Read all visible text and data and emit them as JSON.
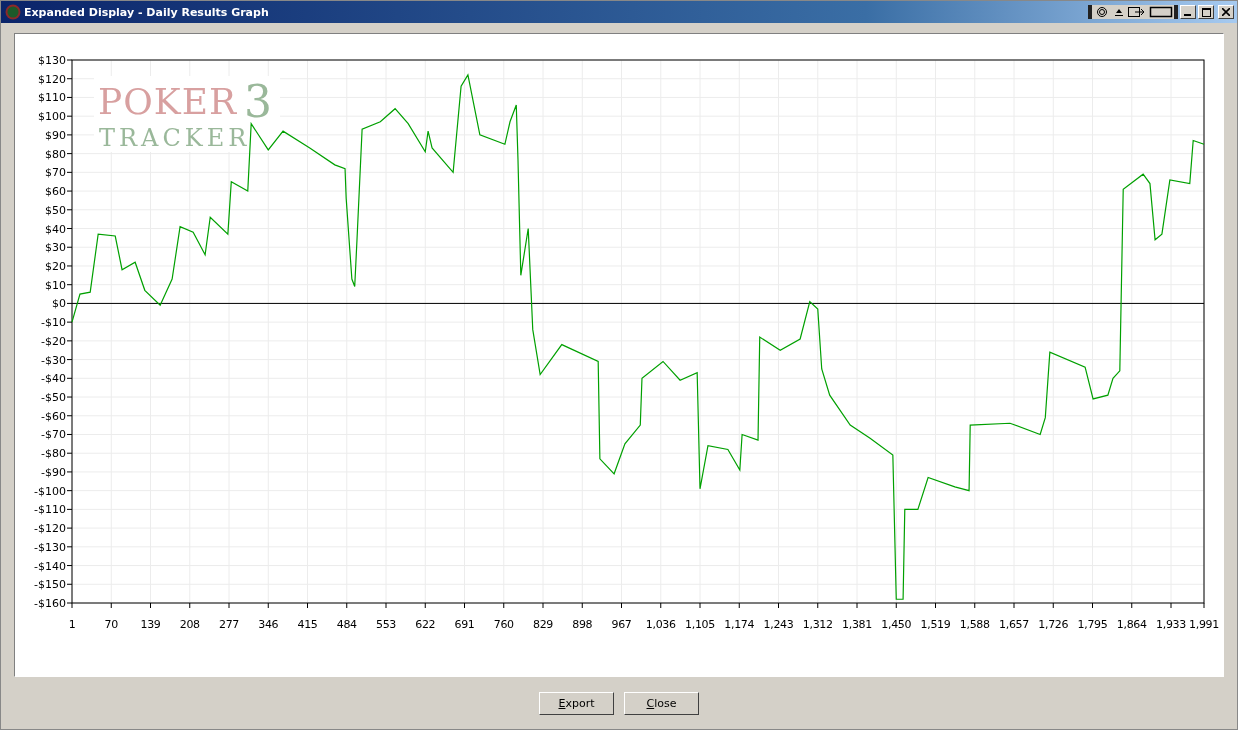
{
  "window": {
    "title": "Expanded Display - Daily Results Graph"
  },
  "graph": {
    "logo": {
      "top": "POKER",
      "bottom": "TRACKER",
      "mark": "3"
    },
    "chart_data": {
      "type": "line",
      "grid": true,
      "xlim": [
        1,
        1991
      ],
      "ylim": [
        -160,
        130
      ],
      "xticks": [
        {
          "value": 1,
          "label": "1"
        },
        {
          "value": 70,
          "label": "70"
        },
        {
          "value": 139,
          "label": "139"
        },
        {
          "value": 208,
          "label": "208"
        },
        {
          "value": 277,
          "label": "277"
        },
        {
          "value": 346,
          "label": "346"
        },
        {
          "value": 415,
          "label": "415"
        },
        {
          "value": 484,
          "label": "484"
        },
        {
          "value": 553,
          "label": "553"
        },
        {
          "value": 622,
          "label": "622"
        },
        {
          "value": 691,
          "label": "691"
        },
        {
          "value": 760,
          "label": "760"
        },
        {
          "value": 829,
          "label": "829"
        },
        {
          "value": 898,
          "label": "898"
        },
        {
          "value": 967,
          "label": "967"
        },
        {
          "value": 1036,
          "label": "1,036"
        },
        {
          "value": 1105,
          "label": "1,105"
        },
        {
          "value": 1174,
          "label": "1,174"
        },
        {
          "value": 1243,
          "label": "1,243"
        },
        {
          "value": 1312,
          "label": "1,312"
        },
        {
          "value": 1381,
          "label": "1,381"
        },
        {
          "value": 1450,
          "label": "1,450"
        },
        {
          "value": 1519,
          "label": "1,519"
        },
        {
          "value": 1588,
          "label": "1,588"
        },
        {
          "value": 1657,
          "label": "1,657"
        },
        {
          "value": 1726,
          "label": "1,726"
        },
        {
          "value": 1795,
          "label": "1,795"
        },
        {
          "value": 1864,
          "label": "1,864"
        },
        {
          "value": 1933,
          "label": "1,933"
        },
        {
          "value": 1991,
          "label": "1,991"
        }
      ],
      "yticks": [
        {
          "value": 130,
          "label": "$130"
        },
        {
          "value": 120,
          "label": "$120"
        },
        {
          "value": 110,
          "label": "$110"
        },
        {
          "value": 100,
          "label": "$100"
        },
        {
          "value": 90,
          "label": "$90"
        },
        {
          "value": 80,
          "label": "$80"
        },
        {
          "value": 70,
          "label": "$70"
        },
        {
          "value": 60,
          "label": "$60"
        },
        {
          "value": 50,
          "label": "$50"
        },
        {
          "value": 40,
          "label": "$40"
        },
        {
          "value": 30,
          "label": "$30"
        },
        {
          "value": 20,
          "label": "$20"
        },
        {
          "value": 10,
          "label": "$10"
        },
        {
          "value": 0,
          "label": "$0"
        },
        {
          "value": -10,
          "label": "-$10"
        },
        {
          "value": -20,
          "label": "-$20"
        },
        {
          "value": -30,
          "label": "-$30"
        },
        {
          "value": -40,
          "label": "-$40"
        },
        {
          "value": -50,
          "label": "-$50"
        },
        {
          "value": -60,
          "label": "-$60"
        },
        {
          "value": -70,
          "label": "-$70"
        },
        {
          "value": -80,
          "label": "-$80"
        },
        {
          "value": -90,
          "label": "-$90"
        },
        {
          "value": -100,
          "label": "-$100"
        },
        {
          "value": -110,
          "label": "-$110"
        },
        {
          "value": -120,
          "label": "-$120"
        },
        {
          "value": -130,
          "label": "-$130"
        },
        {
          "value": -140,
          "label": "-$140"
        },
        {
          "value": -150,
          "label": "-$150"
        },
        {
          "value": -160,
          "label": "-$160"
        }
      ],
      "x": [
        1,
        15,
        33,
        47,
        77,
        89,
        112,
        129,
        156,
        177,
        191,
        214,
        235,
        244,
        275,
        281,
        310,
        316,
        346,
        372,
        419,
        463,
        481,
        483,
        493,
        498,
        502,
        511,
        543,
        569,
        592,
        622,
        627,
        634,
        671,
        685,
        697,
        718,
        762,
        771,
        782,
        785,
        790,
        803,
        811,
        824,
        862,
        926,
        929,
        954,
        973,
        1000,
        1003,
        1040,
        1070,
        1100,
        1105,
        1119,
        1154,
        1175,
        1179,
        1207,
        1210,
        1246,
        1281,
        1298,
        1312,
        1319,
        1333,
        1369,
        1404,
        1444,
        1450,
        1462,
        1465,
        1488,
        1506,
        1553,
        1578,
        1580,
        1650,
        1703,
        1712,
        1720,
        1782,
        1796,
        1822,
        1831,
        1843,
        1849,
        1884,
        1896,
        1905,
        1917,
        1931,
        1966,
        1972,
        1991
      ],
      "series": [
        {
          "color": "#00a000",
          "values": [
            -10,
            5,
            6,
            37,
            36,
            18,
            22,
            7,
            -1,
            13,
            41,
            38,
            26,
            46,
            37,
            65,
            60,
            96,
            82,
            92,
            83,
            74,
            72,
            56,
            13,
            9,
            34,
            93,
            97,
            104,
            96,
            81,
            92,
            83,
            70,
            116,
            122,
            90,
            85,
            97,
            106,
            77,
            15,
            40,
            -14,
            -38,
            -22,
            -31,
            -83,
            -91,
            -75,
            -65,
            -40,
            -31,
            -41,
            -37,
            -99,
            -76,
            -78,
            -89,
            -70,
            -73,
            -18,
            -25,
            -19,
            1,
            -3,
            -35,
            -49,
            -65,
            -72,
            -81,
            -158,
            -158,
            -110,
            -110,
            -93,
            -98,
            -100,
            -65,
            -64,
            -70,
            -61,
            -26,
            -34,
            -51,
            -49,
            -40,
            -36,
            61,
            69,
            64,
            34,
            37,
            66,
            64,
            87,
            85
          ]
        }
      ]
    }
  },
  "buttons": [
    {
      "label": "Export"
    },
    {
      "label": "Close"
    }
  ]
}
